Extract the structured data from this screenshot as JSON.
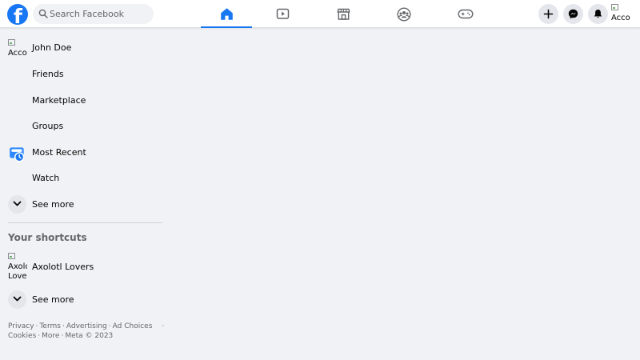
{
  "header": {
    "logo_letter": "f",
    "search_placeholder": "Search Facebook",
    "nav_tabs": [
      {
        "icon": "home-icon",
        "active": true
      },
      {
        "icon": "watch-video-icon",
        "active": false
      },
      {
        "icon": "marketplace-store-icon",
        "active": false
      },
      {
        "icon": "groups-icon",
        "active": false
      },
      {
        "icon": "gaming-controller-icon",
        "active": false
      }
    ],
    "actions": [
      "create-plus-icon",
      "messenger-icon",
      "notifications-bell-icon"
    ],
    "profile_alt": "Acco"
  },
  "sidebar": {
    "items": [
      {
        "label": "John Doe",
        "icon_alt": "Acco"
      },
      {
        "label": "Friends"
      },
      {
        "label": "Marketplace"
      },
      {
        "label": "Groups"
      },
      {
        "label": "Most Recent",
        "icon": "most-recent-feed-icon"
      },
      {
        "label": "Watch"
      },
      {
        "label": "See more",
        "icon": "chevron-down-icon"
      }
    ],
    "shortcuts_title": "Your shortcuts",
    "shortcuts": [
      {
        "label": "Axolotl Lovers",
        "icon_alt_line1": "Axolo",
        "icon_alt_line2": "Love"
      }
    ],
    "shortcuts_see_more": "See more"
  },
  "footer": {
    "links": [
      "Privacy",
      "Terms",
      "Advertising",
      "Ad Choices",
      "Cookies",
      "More"
    ],
    "copyright": "Meta © 2023"
  },
  "colors": {
    "brand_blue": "#1877f2",
    "background": "#f0f2f5",
    "secondary_text": "#65676b",
    "button_gray": "#e4e6eb"
  }
}
